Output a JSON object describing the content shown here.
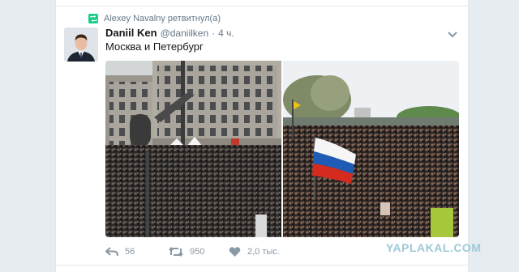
{
  "retweet": {
    "label": "Alexey Navalny ретвитнул(а)"
  },
  "tweet": {
    "name": "Daniil Ken",
    "handle": "@daniilken",
    "separator": "·",
    "time": "4 ч.",
    "text": "Москва и Петербург"
  },
  "actions": {
    "reply_count": "56",
    "retweet_count": "950",
    "like_count": "2,0 тыс."
  },
  "watermark": "YAPLAKAL.COM",
  "colors": {
    "retweet_green": "#19cf86",
    "secondary_text": "#657786",
    "action_gray": "#8899a6",
    "background": "#e6ecf0"
  },
  "icons": [
    "retweet-icon",
    "caret-down-icon",
    "reply-icon",
    "retweet-action-icon",
    "heart-icon"
  ]
}
